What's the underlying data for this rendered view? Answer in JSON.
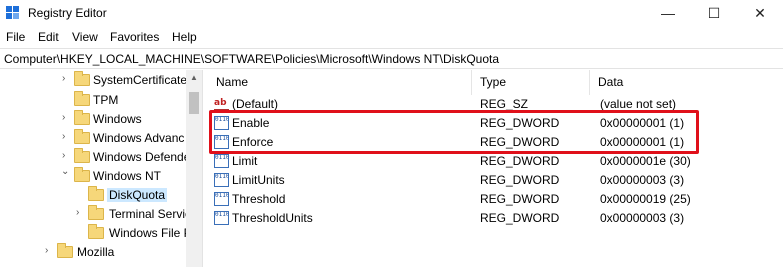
{
  "window": {
    "title": "Registry Editor",
    "minimize": "—",
    "maximize": "☐",
    "close": "✕"
  },
  "menu": [
    "File",
    "Edit",
    "View",
    "Favorites",
    "Help"
  ],
  "address": "Computer\\HKEY_LOCAL_MACHINE\\SOFTWARE\\Policies\\Microsoft\\Windows NT\\DiskQuota",
  "tree": [
    {
      "label": "SystemCertificate",
      "chevron": "›"
    },
    {
      "label": "TPM",
      "chevron": ""
    },
    {
      "label": "Windows",
      "chevron": "›"
    },
    {
      "label": "Windows Advanc",
      "chevron": "›"
    },
    {
      "label": "Windows Defende",
      "chevron": "›"
    },
    {
      "label": "Windows NT",
      "chevron": "⌄"
    },
    {
      "label": "DiskQuota",
      "chevron": "",
      "selected": true
    },
    {
      "label": "Terminal Servic",
      "chevron": "›"
    },
    {
      "label": "Windows File P",
      "chevron": ""
    },
    {
      "label": "Mozilla",
      "chevron": "›"
    }
  ],
  "columns": {
    "name": "Name",
    "type": "Type",
    "data": "Data"
  },
  "values": [
    {
      "icon": "string-value-icon",
      "glyph": "ab",
      "name": "(Default)",
      "type": "REG_SZ",
      "data": "(value not set)"
    },
    {
      "icon": "dword-value-icon",
      "glyph": "0110",
      "name": "Enable",
      "type": "REG_DWORD",
      "data": "0x00000001 (1)"
    },
    {
      "icon": "dword-value-icon",
      "glyph": "0110",
      "name": "Enforce",
      "type": "REG_DWORD",
      "data": "0x00000001 (1)"
    },
    {
      "icon": "dword-value-icon",
      "glyph": "0110",
      "name": "Limit",
      "type": "REG_DWORD",
      "data": "0x0000001e (30)"
    },
    {
      "icon": "dword-value-icon",
      "glyph": "0110",
      "name": "LimitUnits",
      "type": "REG_DWORD",
      "data": "0x00000003 (3)"
    },
    {
      "icon": "dword-value-icon",
      "glyph": "0110",
      "name": "Threshold",
      "type": "REG_DWORD",
      "data": "0x00000019 (25)"
    },
    {
      "icon": "dword-value-icon",
      "glyph": "0110",
      "name": "ThresholdUnits",
      "type": "REG_DWORD",
      "data": "0x00000003 (3)"
    }
  ],
  "colors": {
    "highlight": "#e0101a",
    "selection": "#cce8ff",
    "folder": "#f6d77a"
  }
}
